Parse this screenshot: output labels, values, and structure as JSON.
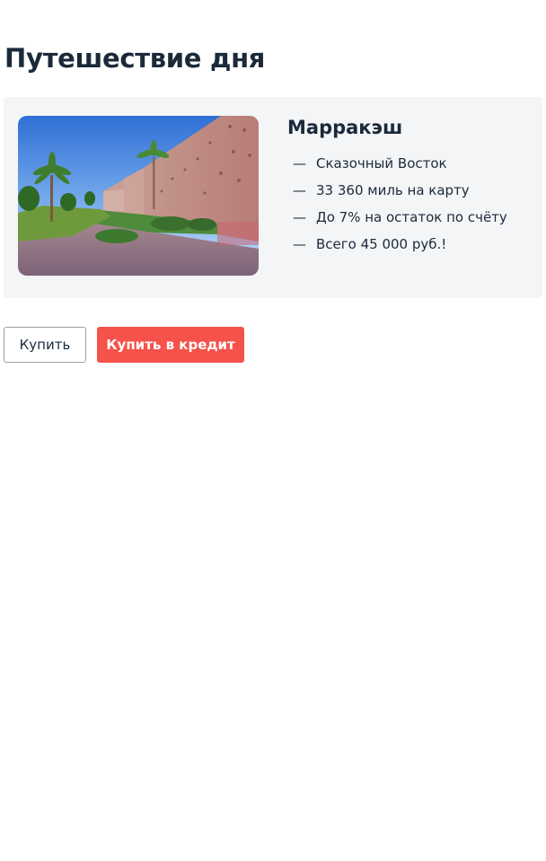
{
  "page": {
    "title": "Путешествие дня"
  },
  "offer": {
    "title": "Марракэш",
    "image_alt": "marrakesh-wall-photo",
    "features": [
      {
        "dash": "—",
        "text": "Сказочный Восток"
      },
      {
        "dash": "—",
        "text": "33 360 миль на карту"
      },
      {
        "dash": "—",
        "text": "До 7% на остаток по счёту"
      },
      {
        "dash": "—",
        "text": "Всего 45 000 руб.!"
      }
    ]
  },
  "actions": {
    "buy_label": "Купить",
    "credit_label": "Купить в кредит"
  },
  "colors": {
    "primary_button": "#f4524a",
    "card_background": "#f4f5f7",
    "text": "#1b2a3a"
  }
}
